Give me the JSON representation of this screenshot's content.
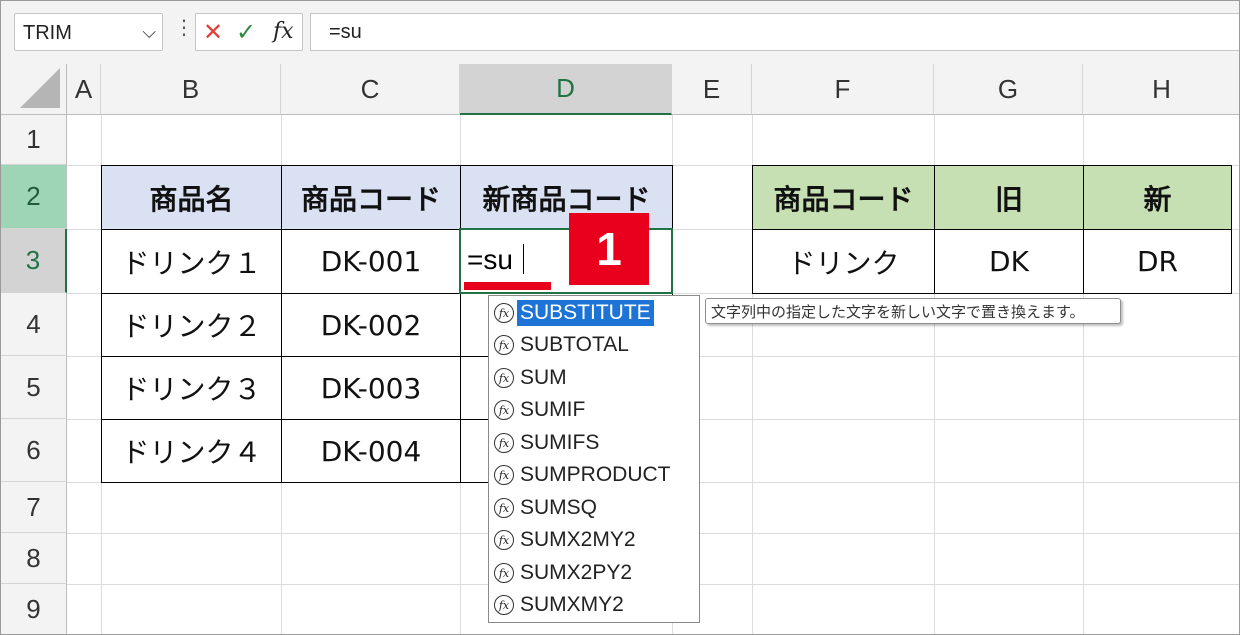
{
  "formula_bar": {
    "name_box": "TRIM",
    "cancel_glyph": "✕",
    "enter_glyph": "✓",
    "fx_label": "fx",
    "formula": "=su"
  },
  "columns": [
    "A",
    "B",
    "C",
    "D",
    "E",
    "F",
    "G",
    "H"
  ],
  "rows": [
    "1",
    "2",
    "3",
    "4",
    "5",
    "6",
    "7",
    "8",
    "9"
  ],
  "table1": {
    "headers": [
      "商品名",
      "商品コード",
      "新商品コード"
    ],
    "rows": [
      [
        "ドリンク１",
        "DK-001"
      ],
      [
        "ドリンク２",
        "DK-002"
      ],
      [
        "ドリンク３",
        "DK-003"
      ],
      [
        "ドリンク４",
        "DK-004"
      ]
    ]
  },
  "table2": {
    "headers": [
      "商品コード",
      "旧",
      "新"
    ],
    "row": [
      "ドリンク",
      "DK",
      "DR"
    ]
  },
  "editing_cell": {
    "text": "=su"
  },
  "badge": "1",
  "autocomplete": {
    "items": [
      "SUBSTITUTE",
      "SUBTOTAL",
      "SUM",
      "SUMIF",
      "SUMIFS",
      "SUMPRODUCT",
      "SUMSQ",
      "SUMX2MY2",
      "SUMX2PY2",
      "SUMXMY2"
    ],
    "icon_glyph": "fx",
    "tooltip": "文字列中の指定した文字を新しい文字で置き換えます。"
  },
  "colors": {
    "accent_green": "#217346",
    "header_blue": "#d9e1f2",
    "header_green": "#c6e0b4",
    "badge_red": "#e8001c",
    "selection_blue": "#1e74d6"
  }
}
